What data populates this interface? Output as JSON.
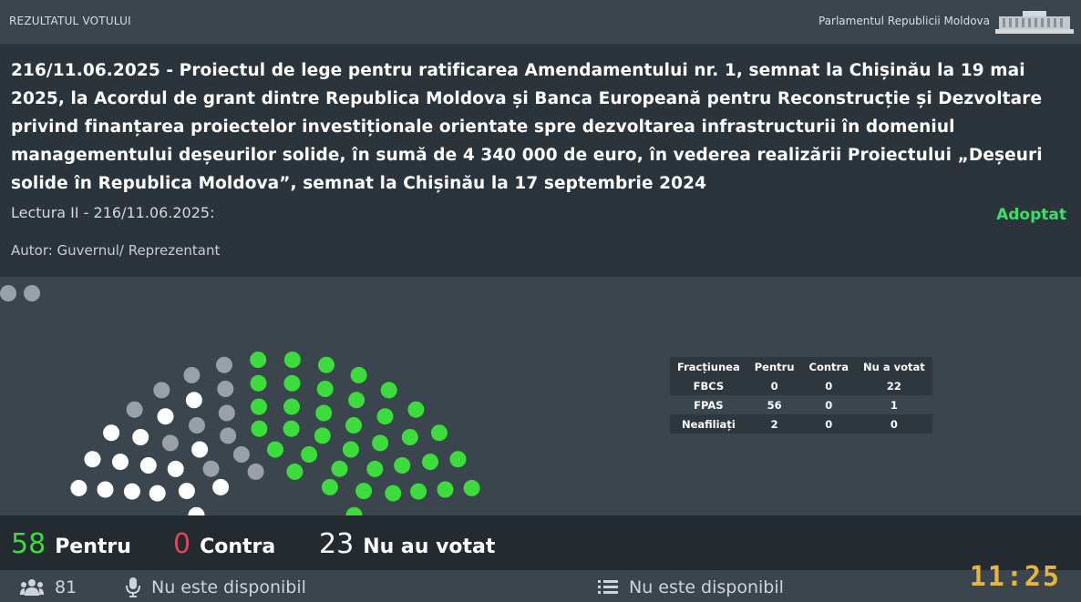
{
  "topbar": {
    "left_label": "REZULTATUL VOTULUI",
    "right_label": "Parlamentul Republicii Moldova"
  },
  "header": {
    "title": "216/11.06.2025 - Proiectul de lege pentru ratificarea Amendamentului nr. 1, semnat la Chișinău la 19 mai 2025, la Acordul de grant dintre Republica Moldova și Banca Europeană pentru Reconstrucție și Dezvoltare privind finanțarea proiectelor investiționale orientate spre dezvoltarea infrastructurii în domeniul managementului deșeurilor solide, în sumă de 4 340 000 de euro, în vederea realizării Proiectului „Deșeuri solide în Republica Moldova”, semnat la Chișinău la 17 septembrie 2024",
    "lectura": "Lectura II - 216/11.06.2025:",
    "status": "Adoptat",
    "autor": "Autor: Guvernul/ Reprezentant"
  },
  "colors": {
    "green": "#3ddc3d",
    "gray": "#9aa1a6",
    "white": "#ffffff",
    "red": "#e0455a",
    "status_green": "#3ddc6b",
    "clock": "#e8b53a"
  },
  "fractions": {
    "headers": [
      "Fracțiunea",
      "Pentru",
      "Contra",
      "Nu a votat"
    ],
    "rows": [
      [
        "FBCS",
        "0",
        "0",
        "22"
      ],
      [
        "FPAS",
        "56",
        "0",
        "1"
      ],
      [
        "Neafiliați",
        "2",
        "0",
        "0"
      ]
    ]
  },
  "totals": {
    "pentru_num": "58",
    "pentru_lbl": "Pentru",
    "contra_num": "0",
    "contra_lbl": "Contra",
    "nuvot_num": "23",
    "nuvot_lbl": "Nu au votat"
  },
  "footer": {
    "members_icon": "people-icon",
    "members_count": "81",
    "mic_icon": "microphone-icon",
    "mic_text": "Nu este disponibil",
    "list_icon": "list-icon",
    "list_text": "Nu este disponibil",
    "clock_h": "11",
    "clock_m": "25"
  }
}
